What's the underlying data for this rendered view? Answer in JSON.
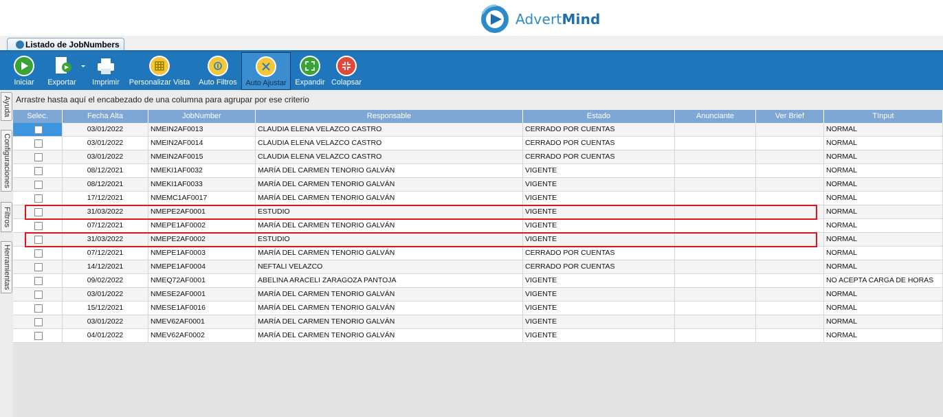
{
  "brand": {
    "name_light": "Advert",
    "name_bold": "Mind"
  },
  "tab": {
    "title": "Listado de JobNumbers"
  },
  "toolbar": {
    "items": [
      {
        "label": "Iniciar",
        "icon": "play-icon"
      },
      {
        "label": "Exportar",
        "icon": "export-icon"
      },
      {
        "label": "Imprimir",
        "icon": "printer-icon"
      },
      {
        "label": "Personalizar Vista",
        "icon": "grid-view-icon"
      },
      {
        "label": "Auto Filtros",
        "icon": "filter-icon"
      },
      {
        "label": "Auto Ajustar",
        "icon": "auto-adjust-icon",
        "active": true
      },
      {
        "label": "Expandir",
        "icon": "expand-icon"
      },
      {
        "label": "Colapsar",
        "icon": "collapse-icon"
      }
    ]
  },
  "side_tabs": [
    "Ayuda",
    "Configuraciones",
    "Filtros",
    "Herramientas"
  ],
  "group_panel": {
    "text": "Arrastre hasta aquí el encabezado de una columna para agrupar por ese criterio"
  },
  "grid": {
    "columns": [
      "Selec.",
      "Fecha Alta",
      "JobNumber",
      "Responsable",
      "Estado",
      "Anunciante",
      "Ver Brief",
      "TInput"
    ],
    "rows": [
      {
        "fecha": "03/01/2022",
        "job": "NMEIN2AF0013",
        "resp": "CLAUDIA ELENA VELAZCO CASTRO",
        "estado": "CERRADO POR CUENTAS",
        "anunciante": "",
        "brief": "",
        "tinput": "NORMAL"
      },
      {
        "fecha": "03/01/2022",
        "job": "NMEIN2AF0014",
        "resp": "CLAUDIA ELENA VELAZCO CASTRO",
        "estado": "CERRADO POR CUENTAS",
        "anunciante": "",
        "brief": "",
        "tinput": "NORMAL"
      },
      {
        "fecha": "03/01/2022",
        "job": "NMEIN2AF0015",
        "resp": "CLAUDIA ELENA VELAZCO CASTRO",
        "estado": "CERRADO POR CUENTAS",
        "anunciante": "",
        "brief": "",
        "tinput": "NORMAL"
      },
      {
        "fecha": "08/12/2021",
        "job": "NMEKI1AF0032",
        "resp": "MARÍA DEL CARMEN TENORIO GALVÁN",
        "estado": "VIGENTE",
        "anunciante": "",
        "brief": "",
        "tinput": "NORMAL"
      },
      {
        "fecha": "08/12/2021",
        "job": "NMEKI1AF0033",
        "resp": "MARÍA DEL CARMEN TENORIO GALVÁN",
        "estado": "VIGENTE",
        "anunciante": "",
        "brief": "",
        "tinput": "NORMAL"
      },
      {
        "fecha": "17/12/2021",
        "job": "NMEMC1AF0017",
        "resp": "MARÍA DEL CARMEN TENORIO GALVÁN",
        "estado": "VIGENTE",
        "anunciante": "",
        "brief": "",
        "tinput": "NORMAL"
      },
      {
        "fecha": "31/03/2022",
        "job": "NMEPE2AF0001",
        "resp": "ESTUDIO",
        "estado": "VIGENTE",
        "anunciante": "",
        "brief": "",
        "tinput": "NORMAL"
      },
      {
        "fecha": "07/12/2021",
        "job": "NMEPE1AF0002",
        "resp": "MARÍA DEL CARMEN TENORIO GALVÁN",
        "estado": "VIGENTE",
        "anunciante": "",
        "brief": "",
        "tinput": "NORMAL"
      },
      {
        "fecha": "31/03/2022",
        "job": "NMEPE2AF0002",
        "resp": "ESTUDIO",
        "estado": "VIGENTE",
        "anunciante": "",
        "brief": "",
        "tinput": "NORMAL"
      },
      {
        "fecha": "07/12/2021",
        "job": "NMEPE1AF0003",
        "resp": "MARÍA DEL CARMEN TENORIO GALVÁN",
        "estado": "CERRADO POR CUENTAS",
        "anunciante": "",
        "brief": "",
        "tinput": "NORMAL"
      },
      {
        "fecha": "14/12/2021",
        "job": "NMEPE1AF0004",
        "resp": "NEFTALI VELAZCO",
        "estado": "CERRADO POR CUENTAS",
        "anunciante": "",
        "brief": "",
        "tinput": "NORMAL"
      },
      {
        "fecha": "09/02/2022",
        "job": "NMEQ72AF0001",
        "resp": "ABELINA ARACELI ZARAGOZA PANTOJA",
        "estado": "VIGENTE",
        "anunciante": "",
        "brief": "",
        "tinput": "NO ACEPTA CARGA DE HORAS"
      },
      {
        "fecha": "03/01/2022",
        "job": "NMESE2AF0001",
        "resp": "MARÍA DEL CARMEN TENORIO GALVÁN",
        "estado": "VIGENTE",
        "anunciante": "",
        "brief": "",
        "tinput": "NORMAL"
      },
      {
        "fecha": "15/12/2021",
        "job": "NMESE1AF0016",
        "resp": "MARÍA DEL CARMEN TENORIO GALVÁN",
        "estado": "VIGENTE",
        "anunciante": "",
        "brief": "",
        "tinput": "NORMAL"
      },
      {
        "fecha": "03/01/2022",
        "job": "NMEV62AF0001",
        "resp": "MARÍA DEL CARMEN TENORIO GALVÁN",
        "estado": "VIGENTE",
        "anunciante": "",
        "brief": "",
        "tinput": "NORMAL"
      },
      {
        "fecha": "04/01/2022",
        "job": "NMEV62AF0002",
        "resp": "MARÍA DEL CARMEN TENORIO GALVÁN",
        "estado": "VIGENTE",
        "anunciante": "",
        "brief": "",
        "tinput": "NORMAL"
      }
    ],
    "highlighted_rows": [
      6,
      8
    ],
    "active_row": 0
  },
  "colors": {
    "ribbon": "#1f76bb",
    "header": "#7ea7d6",
    "highlight": "#e0141a",
    "active_cell": "#3d95e0"
  }
}
